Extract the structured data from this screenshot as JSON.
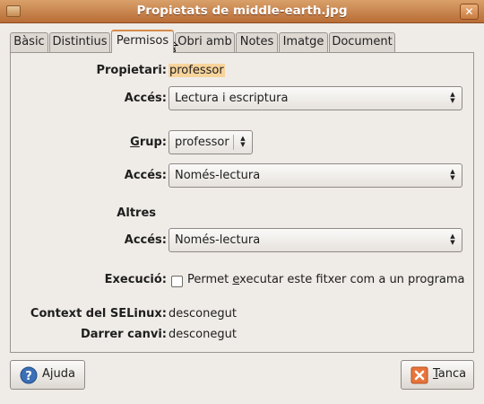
{
  "window": {
    "title": "Propietats de middle-earth.jpg"
  },
  "tabs": [
    {
      "label": "Bàsic"
    },
    {
      "label": "Distintius"
    },
    {
      "label": "Permisos"
    },
    {
      "label": "Obri amb"
    },
    {
      "label": "Notes"
    },
    {
      "label": "Imatge"
    },
    {
      "label": "Document"
    }
  ],
  "owner": {
    "label": "Propietari:",
    "value": "professor"
  },
  "owner_access": {
    "label": "Accés:",
    "value": "Lectura i escriptura"
  },
  "group": {
    "label_underlined": "G",
    "label_rest": "rup:",
    "value": "professor"
  },
  "group_access": {
    "label": "Accés:",
    "value": "Només-lectura"
  },
  "others": {
    "heading": "Altres"
  },
  "others_access": {
    "label": "Accés:",
    "value": "Només-lectura"
  },
  "execute": {
    "label": "Execució:",
    "checked": false,
    "text_before": "Permet ",
    "text_underlined": "e",
    "text_after": "xecutar este fitxer com a un programa"
  },
  "selinux": {
    "label": "Context del SELinux:",
    "value": "desconegut"
  },
  "modified": {
    "label": "Darrer canvi:",
    "value": "desconegut"
  },
  "buttons": {
    "help": {
      "label": "Ajuda",
      "icon": "help-icon"
    },
    "close": {
      "underlined": "T",
      "rest": "anca",
      "icon": "close-icon"
    }
  },
  "colors": {
    "title_bar": "#c17d44",
    "active_tab_accent": "#d78a4a",
    "owner_highlight": "#f8d49c"
  }
}
